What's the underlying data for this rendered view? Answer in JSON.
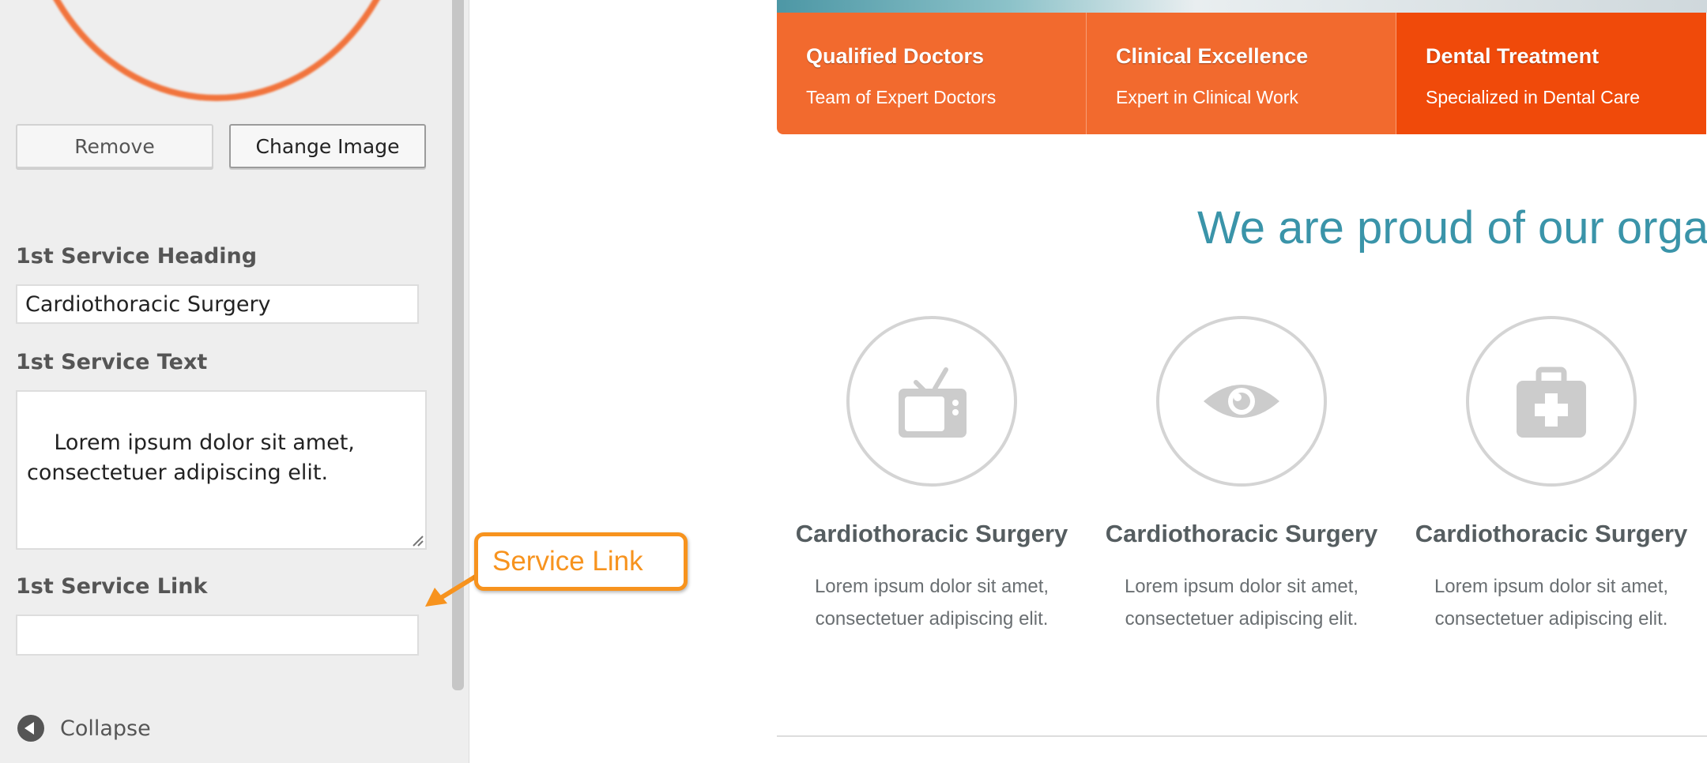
{
  "colors": {
    "accent_orange": "#f26a2e",
    "accent_orange_dark": "#f04a0a",
    "heading_teal": "#3a94a9",
    "callout_orange": "#f7931e",
    "icon_gray": "#cccccc"
  },
  "panel": {
    "remove_label": "Remove",
    "change_image_label": "Change Image",
    "heading_field": {
      "label": "1st Service Heading",
      "value": "Cardiothoracic Surgery"
    },
    "text_field": {
      "label": "1st Service Text",
      "value": "Lorem ipsum dolor sit amet,\nconsectetuer adipiscing elit."
    },
    "link_field": {
      "label": "1st Service Link",
      "value": ""
    },
    "collapse_label": "Collapse"
  },
  "preview": {
    "features": [
      {
        "title": "Qualified Doctors",
        "subtitle": "Team of Expert Doctors"
      },
      {
        "title": "Clinical Excellence",
        "subtitle": "Expert in Clinical Work"
      },
      {
        "title": "Dental Treatment",
        "subtitle": "Specialized in Dental Care"
      }
    ],
    "heading": "We are proud of our orga",
    "services": [
      {
        "icon": "tv-icon",
        "title": "Cardiothoracic Surgery",
        "text": "Lorem ipsum dolor sit amet, consectetuer adipiscing elit."
      },
      {
        "icon": "eye-icon",
        "title": "Cardiothoracic Surgery",
        "text": "Lorem ipsum dolor sit amet, consectetuer adipiscing elit."
      },
      {
        "icon": "medical-kit-icon",
        "title": "Cardiothoracic Surgery",
        "text": "Lorem ipsum dolor sit amet, consectetuer adipiscing elit."
      }
    ]
  },
  "annotation": {
    "label": "Service Link"
  }
}
